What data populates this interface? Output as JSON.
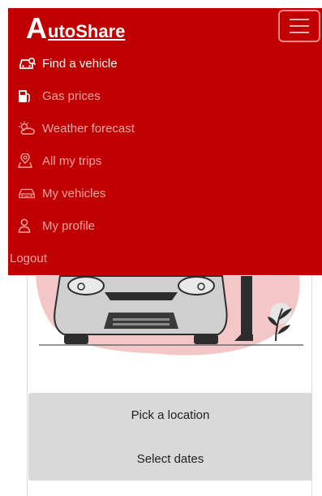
{
  "brand": {
    "letter": "A",
    "rest": "utoShare"
  },
  "nav": {
    "items": [
      {
        "label": "Find a vehicle",
        "icon": "car-search-icon",
        "active": true
      },
      {
        "label": "Gas prices",
        "icon": "gas-pump-icon",
        "active": false
      },
      {
        "label": "Weather forecast",
        "icon": "sun-cloud-icon",
        "active": false
      },
      {
        "label": "All my trips",
        "icon": "map-pin-icon",
        "active": false
      },
      {
        "label": "My vehicles",
        "icon": "car-icon",
        "active": false
      },
      {
        "label": "My profile",
        "icon": "user-icon",
        "active": false
      }
    ],
    "logout": "Logout"
  },
  "form": {
    "location": "Pick a location",
    "dates": "Select dates"
  },
  "colors": {
    "brand": "#c00000",
    "muted_link": "#f2a6a6",
    "form_bg": "#d9d9d9"
  }
}
